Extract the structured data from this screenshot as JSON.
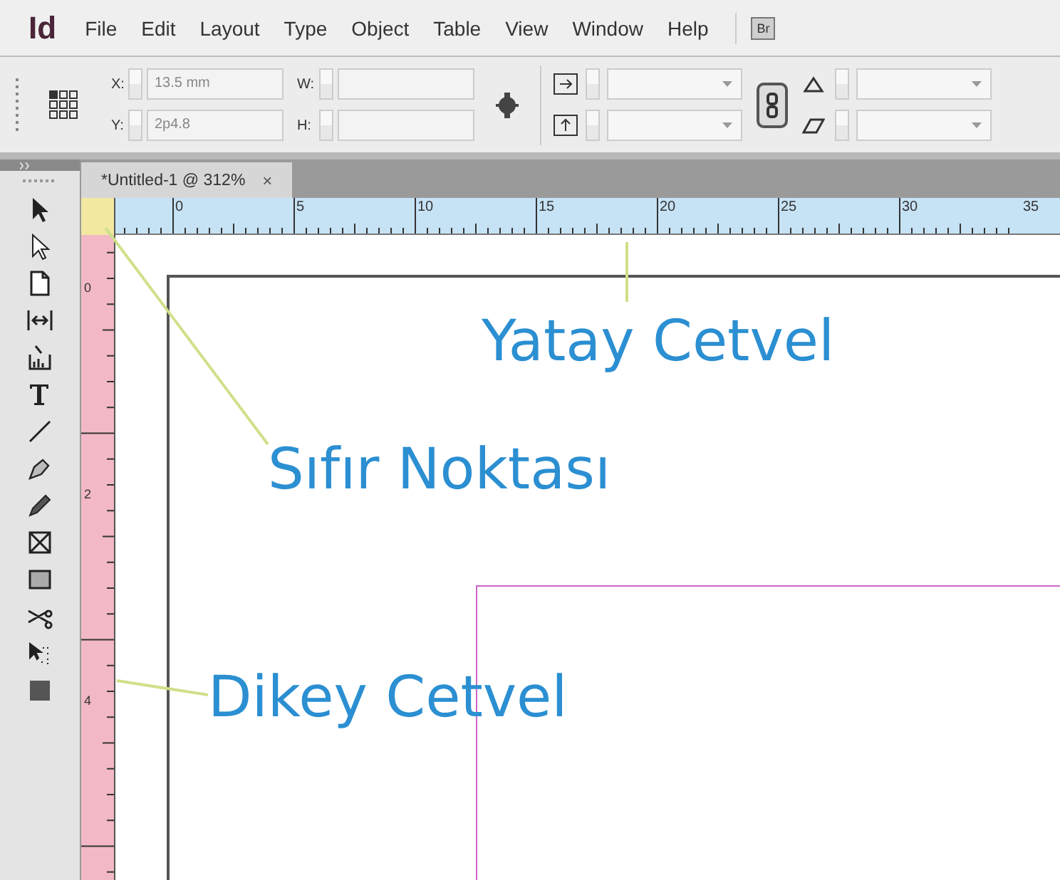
{
  "menu": {
    "logo": "Id",
    "items": [
      "File",
      "Edit",
      "Layout",
      "Type",
      "Object",
      "Table",
      "View",
      "Window",
      "Help"
    ],
    "bridge_badge": "Br"
  },
  "control_panel": {
    "x_label": "X:",
    "x_value": "13.5 mm",
    "y_label": "Y:",
    "y_value": "2p4.8",
    "w_label": "W:",
    "h_label": "H:"
  },
  "document_tab": {
    "title": "*Untitled-1 @ 312%",
    "close": "×"
  },
  "horizontal_ruler": {
    "labels": [
      "0",
      "5",
      "10",
      "15",
      "20",
      "25",
      "30",
      "35"
    ]
  },
  "vertical_ruler": {
    "labels": [
      "0",
      "2",
      "4"
    ]
  },
  "annotations": [
    {
      "kind": "horizontal-ruler",
      "text": "Yatay Cetvel"
    },
    {
      "kind": "zero-point",
      "text": "Sıfır Noktası"
    },
    {
      "kind": "vertical-ruler",
      "text": "Dikey Cetvel"
    }
  ]
}
